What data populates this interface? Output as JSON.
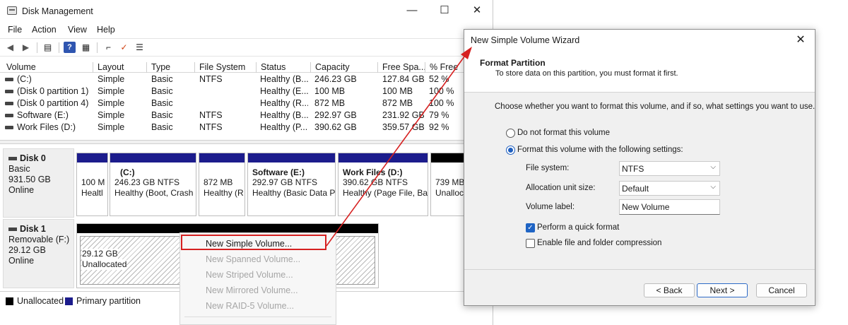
{
  "dm": {
    "title": "Disk Management",
    "win_controls": {
      "minimize": "—",
      "maximize": "☐",
      "close": "✕"
    },
    "menu": [
      "File",
      "Action",
      "View",
      "Help"
    ],
    "columns": [
      "Volume",
      "Layout",
      "Type",
      "File System",
      "Status",
      "Capacity",
      "Free Spa...",
      "% Free"
    ],
    "volumes": [
      [
        "(C:)",
        "Simple",
        "Basic",
        "NTFS",
        "Healthy (B...",
        "246.23 GB",
        "127.84 GB",
        "52 %"
      ],
      [
        "(Disk 0 partition 1)",
        "Simple",
        "Basic",
        "",
        "Healthy (E...",
        "100 MB",
        "100 MB",
        "100 %"
      ],
      [
        "(Disk 0 partition 4)",
        "Simple",
        "Basic",
        "",
        "Healthy (R...",
        "872 MB",
        "872 MB",
        "100 %"
      ],
      [
        "Software (E:)",
        "Simple",
        "Basic",
        "NTFS",
        "Healthy (B...",
        "292.97 GB",
        "231.92 GB",
        "79 %"
      ],
      [
        "Work Files (D:)",
        "Simple",
        "Basic",
        "NTFS",
        "Healthy (P...",
        "390.62 GB",
        "359.57 GB",
        "92 %"
      ]
    ],
    "disk0": {
      "name": "Disk 0",
      "type": "Basic",
      "size": "931.50 GB",
      "status": "Online",
      "partitions": {
        "p1": {
          "size": "100 M",
          "status": "Healtl"
        },
        "c": {
          "name": "(C:)",
          "size": "246.23 GB NTFS",
          "status": "Healthy (Boot, Crash"
        },
        "p4": {
          "size": "872 MB",
          "status": "Healthy (R"
        },
        "e": {
          "name": "Software  (E:)",
          "size": "292.97 GB NTFS",
          "status": "Healthy (Basic Data P"
        },
        "d": {
          "name": "Work Files  (D:)",
          "size": "390.62 GB NTFS",
          "status": "Healthy (Page File, Ba"
        },
        "unalloc": {
          "size": "739 MB",
          "status": "Unalloc"
        }
      }
    },
    "disk1": {
      "name": "Disk 1",
      "type": "Removable (F:)",
      "size": "29.12 GB",
      "status": "Online",
      "partition": {
        "size": "29.12 GB",
        "status": "Unallocated"
      }
    },
    "legend": [
      "Unallocated",
      "Primary partition"
    ],
    "colors": {
      "primary": "#1c1c8c",
      "unallocated": "#000000",
      "highlight": "#d62020"
    }
  },
  "context_menu": {
    "items": [
      "New Simple Volume...",
      "New Spanned Volume...",
      "New Striped Volume...",
      "New Mirrored Volume...",
      "New RAID-5 Volume..."
    ]
  },
  "wizard": {
    "title": "New Simple Volume Wizard",
    "heading": "Format Partition",
    "subheading": "To store data on this partition, you must format it first.",
    "instruction": "Choose whether you want to format this volume, and if so, what settings you want to use.",
    "option_no_format": "Do not format this volume",
    "option_format": "Format this volume with the following settings:",
    "fs_label": "File system:",
    "fs_value": "NTFS",
    "alloc_label": "Allocation unit size:",
    "alloc_value": "Default",
    "vol_label_label": "Volume label:",
    "vol_label_value": "New Volume",
    "quick_format": "Perform a quick format",
    "compression": "Enable file and folder compression",
    "buttons": {
      "back": "< Back",
      "next": "Next >",
      "cancel": "Cancel"
    },
    "close": "✕"
  }
}
